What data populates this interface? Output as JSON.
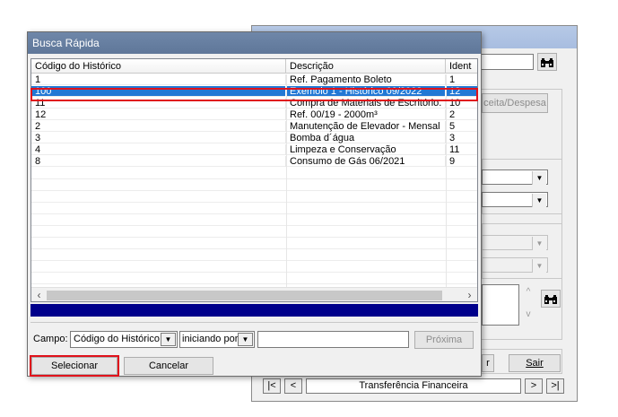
{
  "background_window": {
    "income_expense_label": "ceita/Despesa",
    "exit_label": "Sair",
    "partial_button_label": "r",
    "nav_first": "|<",
    "nav_prev": "<",
    "record_label": "Transferência Financeira",
    "nav_next": ">",
    "nav_last": ">|",
    "binoculars_icon": "binoculars-icon"
  },
  "dialog": {
    "title": "Busca Rápida",
    "columns": [
      "Código do Histórico",
      "Descrição",
      "Ident"
    ],
    "rows": [
      {
        "code": "1",
        "description": "Ref. Pagamento Boleto",
        "ident": "1"
      },
      {
        "code": "100",
        "description": "Exemolo 1 - Histórico 09/2022",
        "ident": "12"
      },
      {
        "code": "11",
        "description": "Compra de Materiais de Escritório.",
        "ident": "10"
      },
      {
        "code": "12",
        "description": "Ref. 00/19 -   2000m³",
        "ident": "2"
      },
      {
        "code": "2",
        "description": "Manutenção de Elevador - Mensal",
        "ident": "5"
      },
      {
        "code": "3",
        "description": "Bomba d´água",
        "ident": "3"
      },
      {
        "code": "4",
        "description": "Limpeza e Conservação",
        "ident": "11"
      },
      {
        "code": "8",
        "description": "Consumo de Gás 06/2021",
        "ident": "9"
      }
    ],
    "selected_row_index": 1,
    "search": {
      "field_label": "Campo:",
      "field_value": "Código do Histórico",
      "mode_value": "iniciando por",
      "text_value": "",
      "next_label": "Próxima"
    },
    "select_label": "Selecionar",
    "cancel_label": "Cancelar"
  },
  "colors": {
    "selection": "#2278d4",
    "highlight_box": "#e0121b",
    "status_bar": "#00008b",
    "dialog_title": "#6f87a9"
  }
}
